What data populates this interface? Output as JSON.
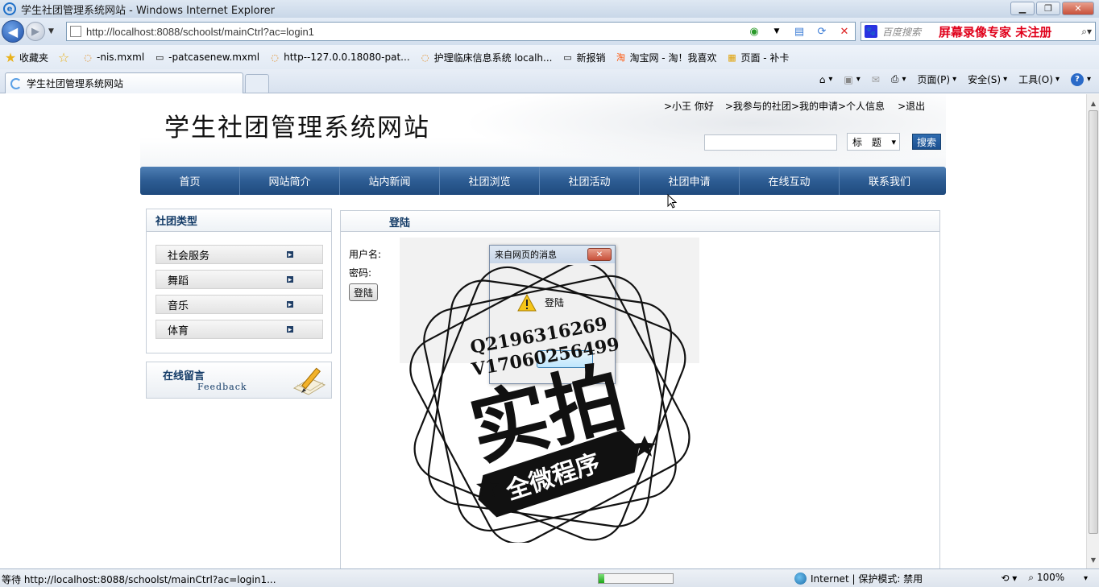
{
  "window": {
    "title": "学生社团管理系统网站 - Windows Internet Explorer",
    "minimize": "▁",
    "restore": "❐",
    "close": "✕"
  },
  "nav": {
    "url": "http://localhost:8088/schoolst/mainCtrl?ac=login1",
    "search_placeholder": "百度搜索",
    "recorder_text": "屏幕录像专家  未注册"
  },
  "favorites": {
    "label": "收藏夹",
    "items": [
      "-nis.mxml",
      "-patcasenew.mxml",
      "http--127.0.0.18080-pat...",
      "护理临床信息系统 localh...",
      "新报销",
      "淘宝网 - 淘！我喜欢",
      "页面 - 补卡"
    ]
  },
  "tab": {
    "title": "学生社团管理系统网站"
  },
  "commands": {
    "page": "页面(P)",
    "safety": "安全(S)",
    "tools": "工具(O)",
    "help": "?"
  },
  "site": {
    "title": "学生社团管理系统网站",
    "user_links": [
      ">小王  你好",
      ">我参与的社团",
      ">我的申请",
      ">个人信息",
      ">退出"
    ],
    "search_select": "标 题",
    "search_button": "搜索",
    "menu": [
      "首页",
      "网站简介",
      "站内新闻",
      "社团浏览",
      "社团活动",
      "社团申请",
      "在线互动",
      "联系我们"
    ],
    "categories_title": "社团类型",
    "categories": [
      "社会服务",
      "舞蹈",
      "音乐",
      "体育"
    ],
    "feedback_title": "在线留言",
    "feedback_sub": "Feedback",
    "login_title": "登陆",
    "username_label": "用户名:",
    "password_label": "密码:",
    "login_button": "登陆"
  },
  "dialog": {
    "title": "来自网页的消息",
    "message": "登陆"
  },
  "watermark": {
    "line1": "Q2196316269",
    "line2": "V17060256499",
    "main": "实拍",
    "ribbon": "全微程序"
  },
  "status": {
    "text": "等待 http://localhost:8088/schoolst/mainCtrl?ac=login1...",
    "progress": 0.08,
    "zone": "Internet | 保护模式: 禁用",
    "zoom": "100%"
  },
  "colors": {
    "nav_blue": "#2d5c93",
    "heading_blue": "#123a66",
    "watermark_black": "#111111"
  }
}
